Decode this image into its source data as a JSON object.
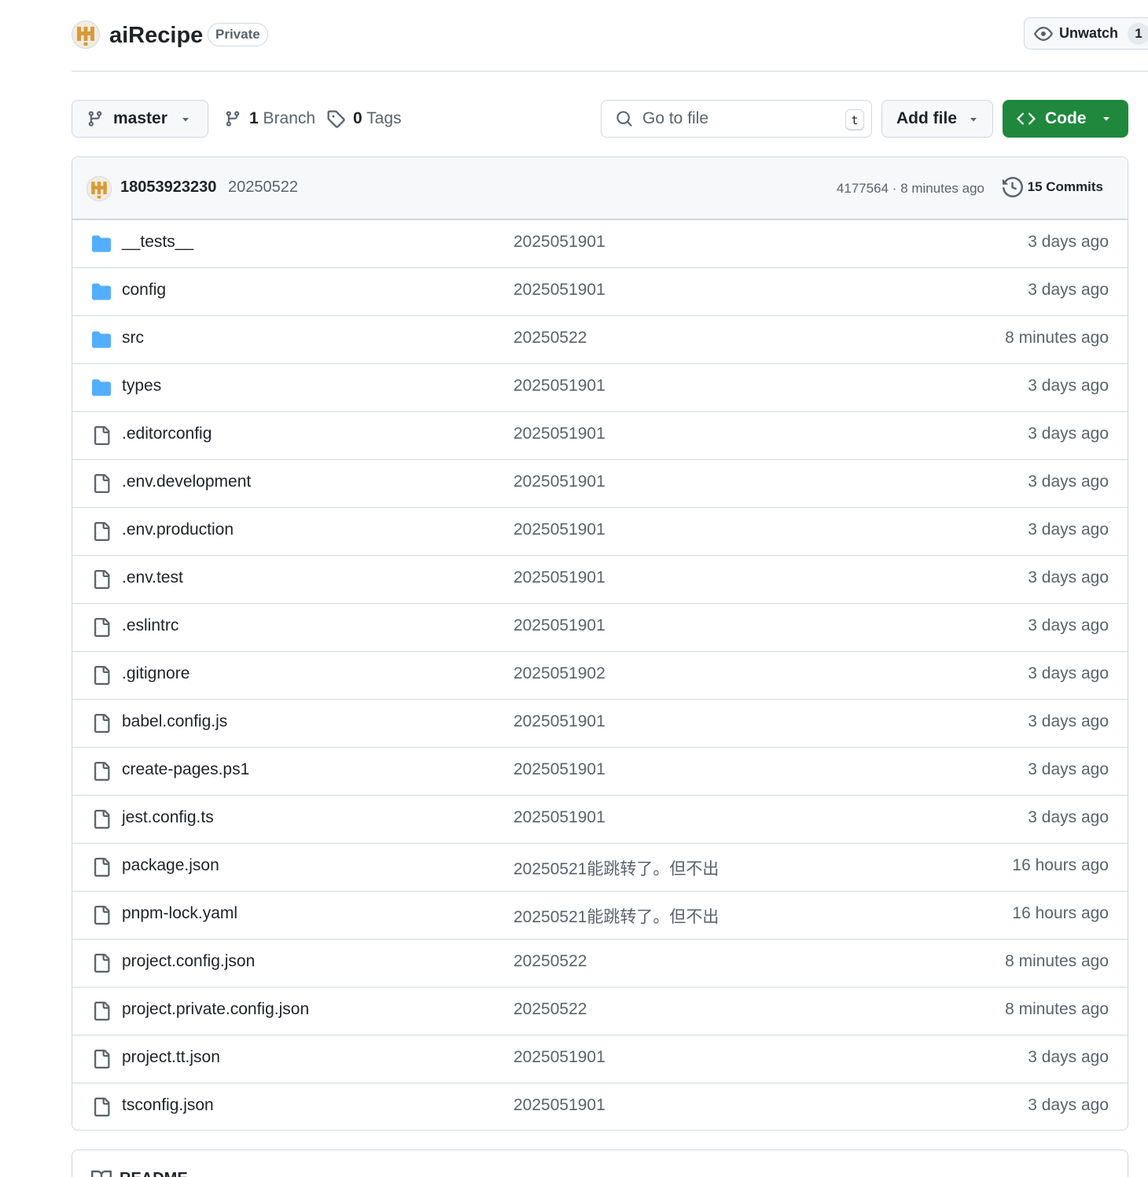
{
  "repo": {
    "name": "aiRecipe",
    "visibility": "Private",
    "watch_label": "Unwatch",
    "watch_count": "1",
    "brand_color": "#d99a3b"
  },
  "toolbar": {
    "branch_name": "master",
    "branch_count": "1",
    "branch_word": "Branch",
    "tag_count": "0",
    "tag_word": "Tags",
    "search_placeholder": "Go to file",
    "search_shortcut": "t",
    "add_file_label": "Add file",
    "code_label": "Code",
    "code_color": "#1f883d"
  },
  "commit": {
    "author": "18053923230",
    "message": "20250522",
    "meta": "4177564 · 8 minutes ago",
    "commits_label": "15 Commits"
  },
  "files": [
    {
      "name": "__tests__",
      "type": "folder",
      "message": "2025051901",
      "time": "3 days ago"
    },
    {
      "name": "config",
      "type": "folder",
      "message": "2025051901",
      "time": "3 days ago"
    },
    {
      "name": "src",
      "type": "folder",
      "message": "20250522",
      "time": "8 minutes ago"
    },
    {
      "name": "types",
      "type": "folder",
      "message": "2025051901",
      "time": "3 days ago"
    },
    {
      "name": ".editorconfig",
      "type": "file",
      "message": "2025051901",
      "time": "3 days ago"
    },
    {
      "name": ".env.development",
      "type": "file",
      "message": "2025051901",
      "time": "3 days ago"
    },
    {
      "name": ".env.production",
      "type": "file",
      "message": "2025051901",
      "time": "3 days ago"
    },
    {
      "name": ".env.test",
      "type": "file",
      "message": "2025051901",
      "time": "3 days ago"
    },
    {
      "name": ".eslintrc",
      "type": "file",
      "message": "2025051901",
      "time": "3 days ago"
    },
    {
      "name": ".gitignore",
      "type": "file",
      "message": "2025051902",
      "time": "3 days ago"
    },
    {
      "name": "babel.config.js",
      "type": "file",
      "message": "2025051901",
      "time": "3 days ago"
    },
    {
      "name": "create-pages.ps1",
      "type": "file",
      "message": "2025051901",
      "time": "3 days ago"
    },
    {
      "name": "jest.config.ts",
      "type": "file",
      "message": "2025051901",
      "time": "3 days ago"
    },
    {
      "name": "package.json",
      "type": "file",
      "message": "20250521能跳转了。但不出",
      "time": "16 hours ago"
    },
    {
      "name": "pnpm-lock.yaml",
      "type": "file",
      "message": "20250521能跳转了。但不出",
      "time": "16 hours ago"
    },
    {
      "name": "project.config.json",
      "type": "file",
      "message": "20250522",
      "time": "8 minutes ago"
    },
    {
      "name": "project.private.config.json",
      "type": "file",
      "message": "20250522",
      "time": "8 minutes ago"
    },
    {
      "name": "project.tt.json",
      "type": "file",
      "message": "2025051901",
      "time": "3 days ago"
    },
    {
      "name": "tsconfig.json",
      "type": "file",
      "message": "2025051901",
      "time": "3 days ago"
    }
  ],
  "readme": {
    "label": "README"
  },
  "icons": {
    "folder": "folder-icon",
    "file": "file-icon",
    "folder_color": "#54aeff"
  }
}
